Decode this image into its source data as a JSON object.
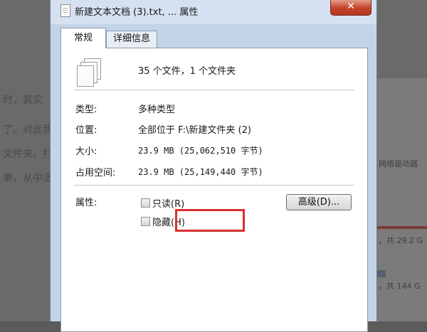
{
  "background": {
    "left_text": [
      "时，其实",
      "了。对此我",
      "文件夹。打",
      "单，从中选"
    ],
    "right_text": [
      "网络驱动器",
      "，共 29.2 G",
      "，共 144 G"
    ]
  },
  "dialog": {
    "title": "新建文本文档 (3).txt, ... 属性",
    "close_label": "✕",
    "tabs": [
      "常规",
      "详细信息"
    ],
    "summary": "35 个文件，1 个文件夹",
    "rows": [
      {
        "label": "类型:",
        "value": "多种类型"
      },
      {
        "label": "位置:",
        "value": "全部位于 F:\\新建文件夹 (2)"
      },
      {
        "label": "大小:",
        "value": "23.9 MB (25,062,510 字节)"
      },
      {
        "label": "占用空间:",
        "value": "23.9 MB (25,149,440 字节)"
      }
    ],
    "attributes_label": "属性:",
    "readonly_label": "只读(R)",
    "hidden_label": "隐藏(H)",
    "advanced_label": "高级(D)..."
  },
  "colors": {
    "highlight": "#d7302e",
    "close_button": "#c3432a"
  }
}
